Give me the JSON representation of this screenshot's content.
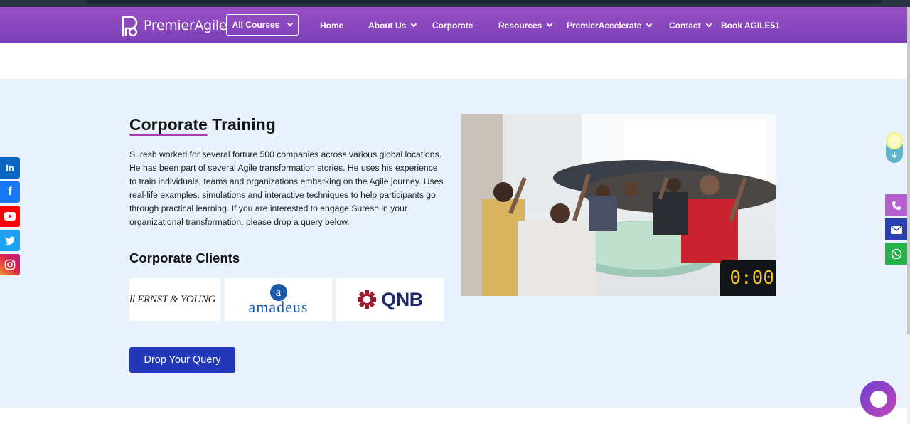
{
  "navbar": {
    "logo_text": "PremierAgile",
    "all_courses": "All Courses",
    "items": [
      {
        "label": "Home",
        "has_menu": false
      },
      {
        "label": "About Us",
        "has_menu": true
      },
      {
        "label": "Corporate",
        "has_menu": false
      },
      {
        "label": "Resources",
        "has_menu": true
      },
      {
        "label": "PremierAccelerate",
        "has_menu": true
      },
      {
        "label": "Contact",
        "has_menu": true
      },
      {
        "label": "Book AGILE51",
        "has_menu": false
      }
    ]
  },
  "section": {
    "title_highlight": "Corporate",
    "title_rest": " Training",
    "description": "Suresh worked for several forture 500 companies across various global locations. He has been part of several Agile transformation stories. He uses his experience to train individuals, teams and organizations embarking on the Agile journey. Uses real-life examples, simulations and interactive techniques to help participants go through practical learning. If you are interested to engage Suresh in your organizational transformation, please drop a query below.",
    "clients_heading": "Corporate Clients",
    "clients": [
      {
        "name": "Ernst & Young",
        "logo_text": "ERNST & YOUNG"
      },
      {
        "name": "Amadeus",
        "logo_letter": "a",
        "logo_text": "amadeus"
      },
      {
        "name": "QNB",
        "logo_text": "QNB"
      }
    ],
    "cta": "Drop Your Query",
    "photo_timer": "0:00"
  },
  "social": [
    {
      "icon": "linkedin-icon",
      "glyph": "in",
      "color": "#0a66c2"
    },
    {
      "icon": "facebook-icon",
      "glyph": "f",
      "color": "#1877f2"
    },
    {
      "icon": "youtube-icon",
      "glyph": "▶",
      "color": "#ff0000"
    },
    {
      "icon": "twitter-icon",
      "glyph": "🐦",
      "color": "#1da1f2"
    },
    {
      "icon": "instagram-icon",
      "glyph": "◎",
      "color": "#e1306c"
    }
  ],
  "contact_bar": [
    {
      "icon": "phone-icon",
      "color": "#b65fd0"
    },
    {
      "icon": "mail-icon",
      "color": "#2a3fb0"
    },
    {
      "icon": "whatsapp-icon",
      "color": "#25b24a"
    }
  ],
  "colors": {
    "nav_gradient_start": "#9a4fc6",
    "nav_gradient_end": "#7a3fb5",
    "section_bg": "#e8f1fc",
    "accent_underline": "#a53db5",
    "cta_bg": "#2238b8"
  }
}
